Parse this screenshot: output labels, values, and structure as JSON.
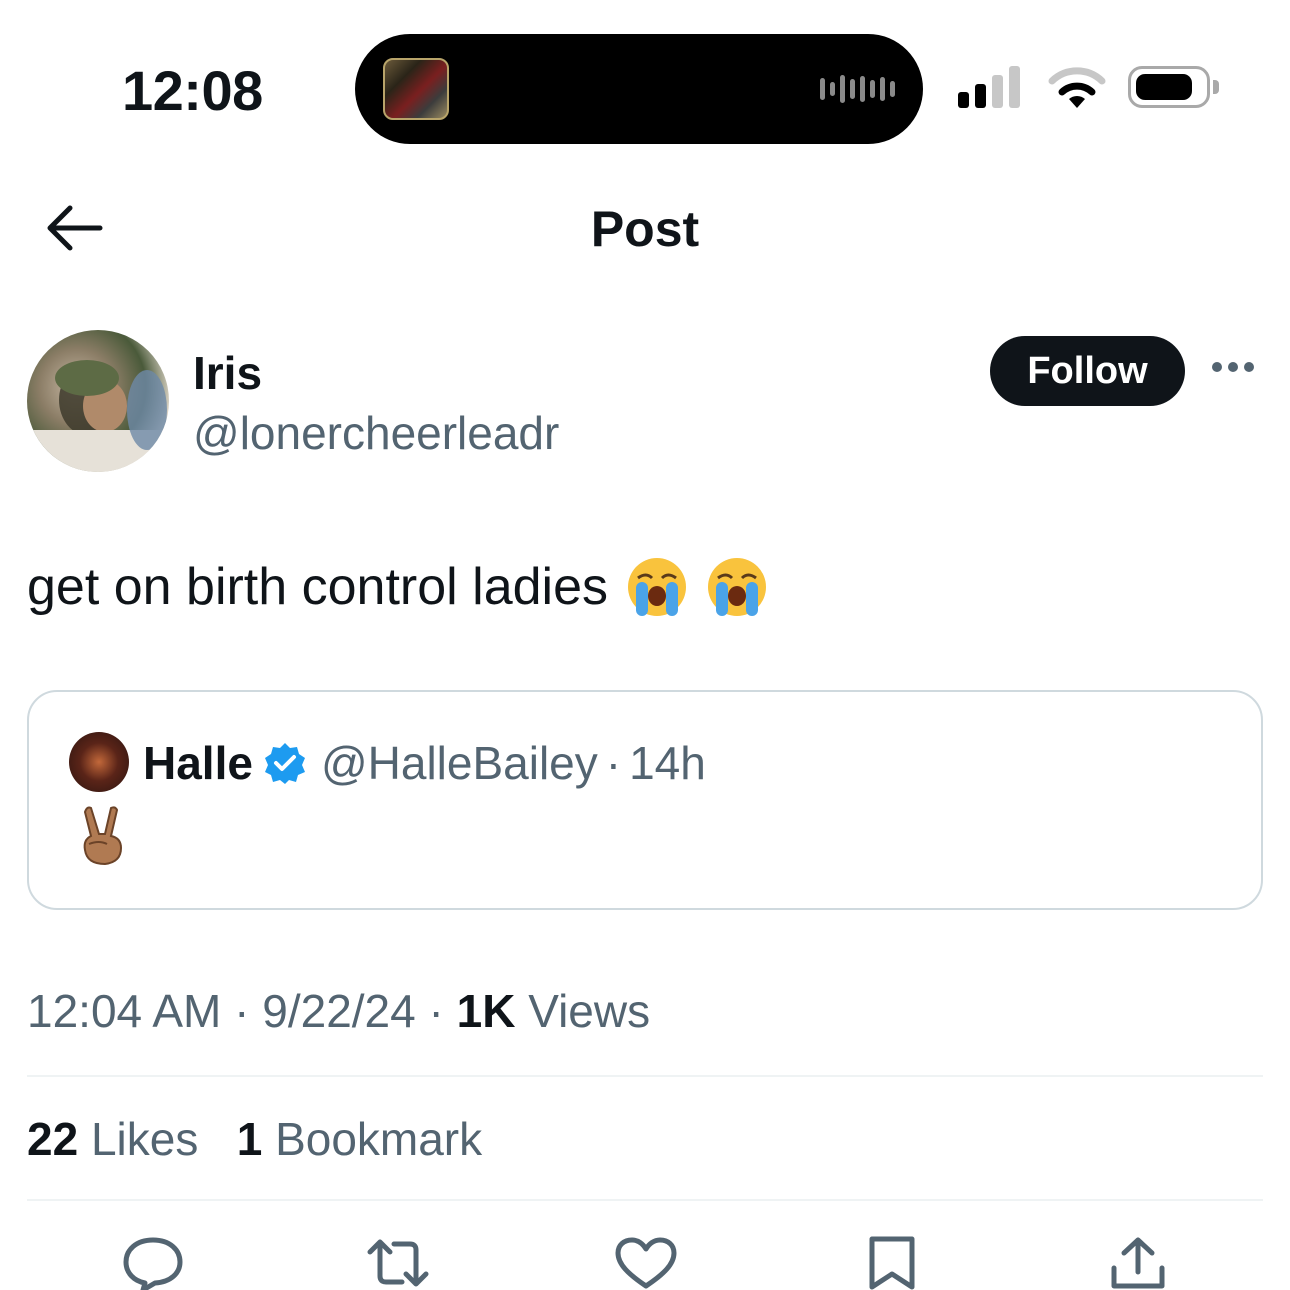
{
  "status_bar": {
    "time": "12:08"
  },
  "header": {
    "title": "Post"
  },
  "post": {
    "author": {
      "name": "Iris",
      "handle": "@lonercheerleadr"
    },
    "follow_label": "Follow",
    "text": "get on birth control ladies",
    "text_emojis": [
      "loudly-crying-face",
      "loudly-crying-face"
    ],
    "quoted": {
      "name": "Halle",
      "verified": true,
      "handle": "@HalleBailey",
      "separator": "·",
      "time": "14h",
      "body_emoji": "victory-hand"
    },
    "meta": {
      "time": "12:04 AM",
      "separator": "·",
      "date": "9/22/24",
      "views_count": "1K",
      "views_label": "Views"
    },
    "stats": {
      "likes_count": "22",
      "likes_label": "Likes",
      "bookmarks_count": "1",
      "bookmarks_label": "Bookmark"
    }
  },
  "actions": [
    "reply-icon",
    "repost-icon",
    "like-icon",
    "bookmark-icon",
    "share-icon"
  ],
  "colors": {
    "text_primary": "#0f1419",
    "text_secondary": "#536471",
    "border": "#cfd9de",
    "verified": "#1d9bf0"
  }
}
